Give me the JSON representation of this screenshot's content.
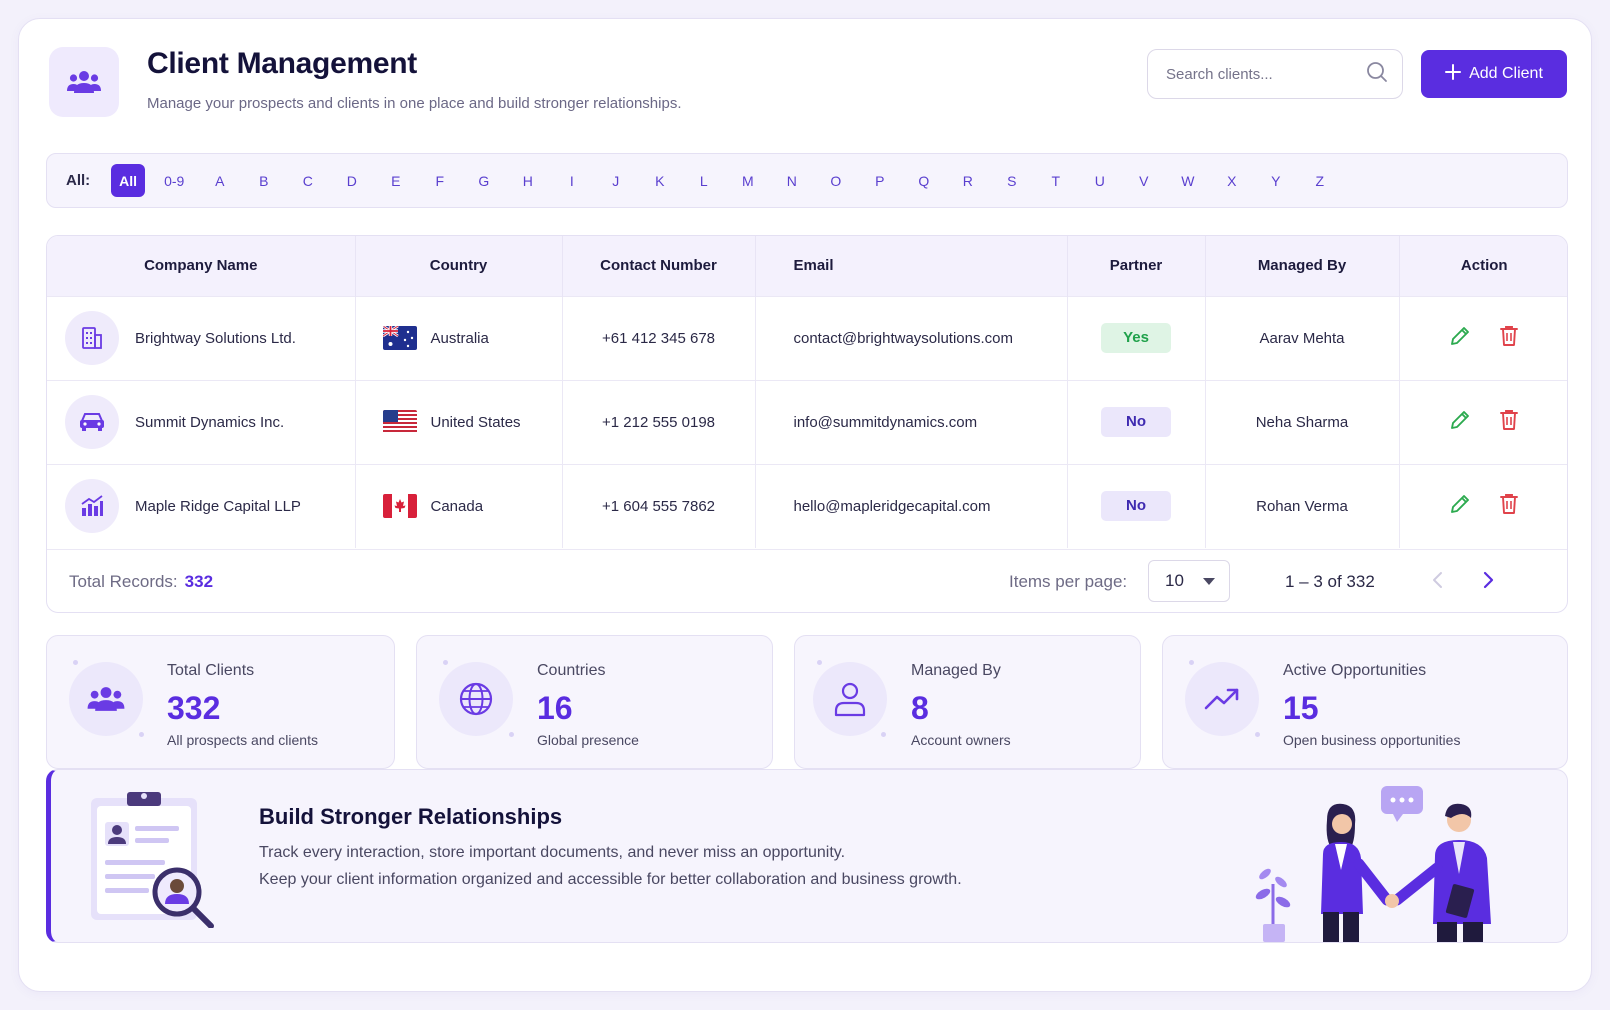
{
  "header": {
    "title": "Client Management",
    "subtitle": "Manage your prospects and clients in one place and build stronger relationships.",
    "icon": "users-icon",
    "search_placeholder": "Search clients...",
    "add_label": "Add Client"
  },
  "alphabet": {
    "label": "All:",
    "items": [
      "All",
      "0-9",
      "A",
      "B",
      "C",
      "D",
      "E",
      "F",
      "G",
      "H",
      "I",
      "J",
      "K",
      "L",
      "M",
      "N",
      "O",
      "P",
      "Q",
      "R",
      "S",
      "T",
      "U",
      "V",
      "W",
      "X",
      "Y",
      "Z"
    ],
    "active": "All"
  },
  "table": {
    "columns": [
      "Company Name",
      "Country",
      "Contact Number",
      "Email",
      "Partner",
      "Managed By",
      "Action"
    ],
    "rows": [
      {
        "company": "Brightway Solutions Ltd.",
        "icon": "building-icon",
        "country": "Australia",
        "flag": "australia-flag-icon",
        "phone": "+61 412 345 678",
        "email": "contact@brightwaysolutions.com",
        "partner": "Yes",
        "manager": "Aarav Mehta"
      },
      {
        "company": "Summit Dynamics Inc.",
        "icon": "car-icon",
        "country": "United States",
        "flag": "us-flag-icon",
        "phone": "+1 212 555 0198",
        "email": "info@summitdynamics.com",
        "partner": "No",
        "manager": "Neha Sharma"
      },
      {
        "company": "Maple Ridge Capital LLP",
        "icon": "chart-icon",
        "country": "Canada",
        "flag": "canada-flag-icon",
        "phone": "+1 604 555 7862",
        "email": "hello@mapleridgecapital.com",
        "partner": "No",
        "manager": "Rohan Verma"
      }
    ],
    "footer": {
      "total_label": "Total Records:",
      "total_value": "332",
      "ipp_label": "Items per page:",
      "ipp_value": "10",
      "range": "1 – 3 of 332"
    }
  },
  "stats": [
    {
      "label": "Total Clients",
      "value": "332",
      "sub": "All prospects and clients",
      "icon": "users-icon"
    },
    {
      "label": "Countries",
      "value": "16",
      "sub": "Global presence",
      "icon": "globe-icon"
    },
    {
      "label": "Managed By",
      "value": "8",
      "sub": "Account owners",
      "icon": "user-icon"
    },
    {
      "label": "Active Opportunities",
      "value": "15",
      "sub": "Open business opportunities",
      "icon": "trending-up-icon"
    }
  ],
  "banner": {
    "title": "Build Stronger Relationships",
    "line1": "Track every interaction, store important documents, and never miss an opportunity.",
    "line2": "Keep your client information organized and accessible for better collaboration and business growth."
  },
  "colors": {
    "accent": "#5a2de0",
    "yes_bg": "#dff4e5",
    "yes_text": "#20a14b",
    "no_bg": "#ebe7fb",
    "no_text": "#3e2ab0"
  }
}
